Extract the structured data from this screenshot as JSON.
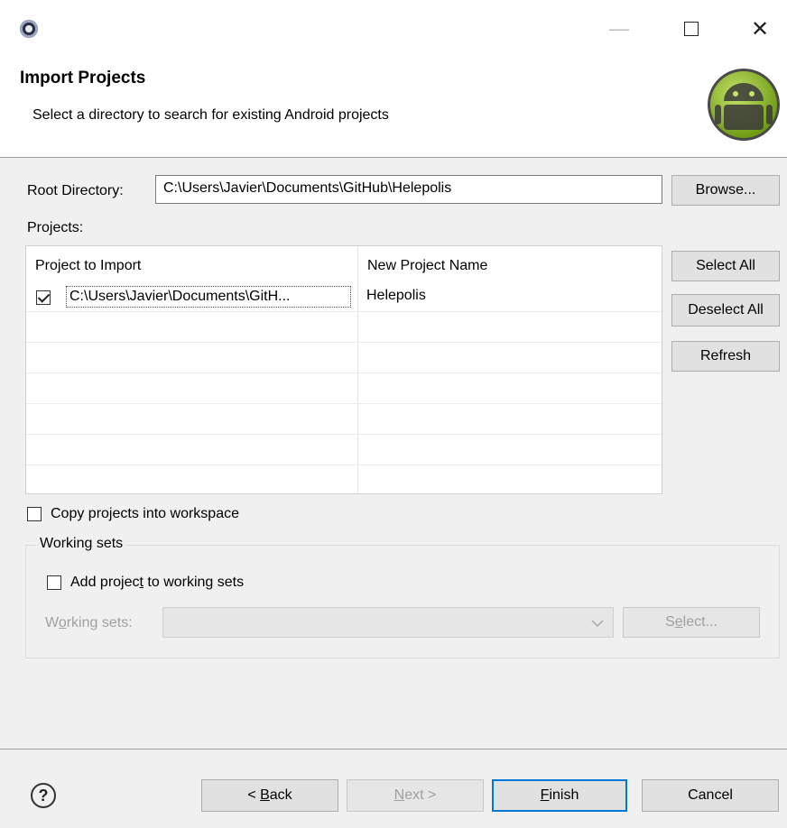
{
  "window": {
    "min_label": "—",
    "close_label": "✕"
  },
  "header": {
    "title": "Import Projects",
    "description": "Select a directory to search for existing Android projects"
  },
  "root": {
    "label": "Root Directory:",
    "value": "C:\\Users\\Javier\\Documents\\GitHub\\Helepolis",
    "browse_label": "Browse..."
  },
  "projects": {
    "label": "Projects:",
    "columns": [
      "Project to Import",
      "New Project Name"
    ],
    "rows": [
      {
        "checked": true,
        "path": "C:\\Users\\Javier\\Documents\\GitH...",
        "name": "Helepolis"
      }
    ],
    "select_all_label": "Select All",
    "deselect_all_label": "Deselect All",
    "refresh_label": "Refresh"
  },
  "copy_option": {
    "label": "Copy projects into workspace",
    "checked": false
  },
  "working_sets": {
    "group_title": "Working sets",
    "add_label_pre": "Add projec",
    "add_label_ul": "t",
    "add_label_post": " to working sets",
    "checked": false,
    "field_label_pre": "W",
    "field_label_ul": "o",
    "field_label_post": "rking sets:",
    "field_value": "",
    "select_pre": "S",
    "select_ul": "e",
    "select_post": "lect..."
  },
  "footer": {
    "help_label": "?",
    "back_pre": "< ",
    "back_ul": "B",
    "back_post": "ack",
    "next_ul": "N",
    "next_post": "ext >",
    "finish_ul": "F",
    "finish_post": "inish",
    "cancel_label": "Cancel"
  },
  "colors": {
    "accent": "#0078d7",
    "android_green": "#97c024"
  }
}
